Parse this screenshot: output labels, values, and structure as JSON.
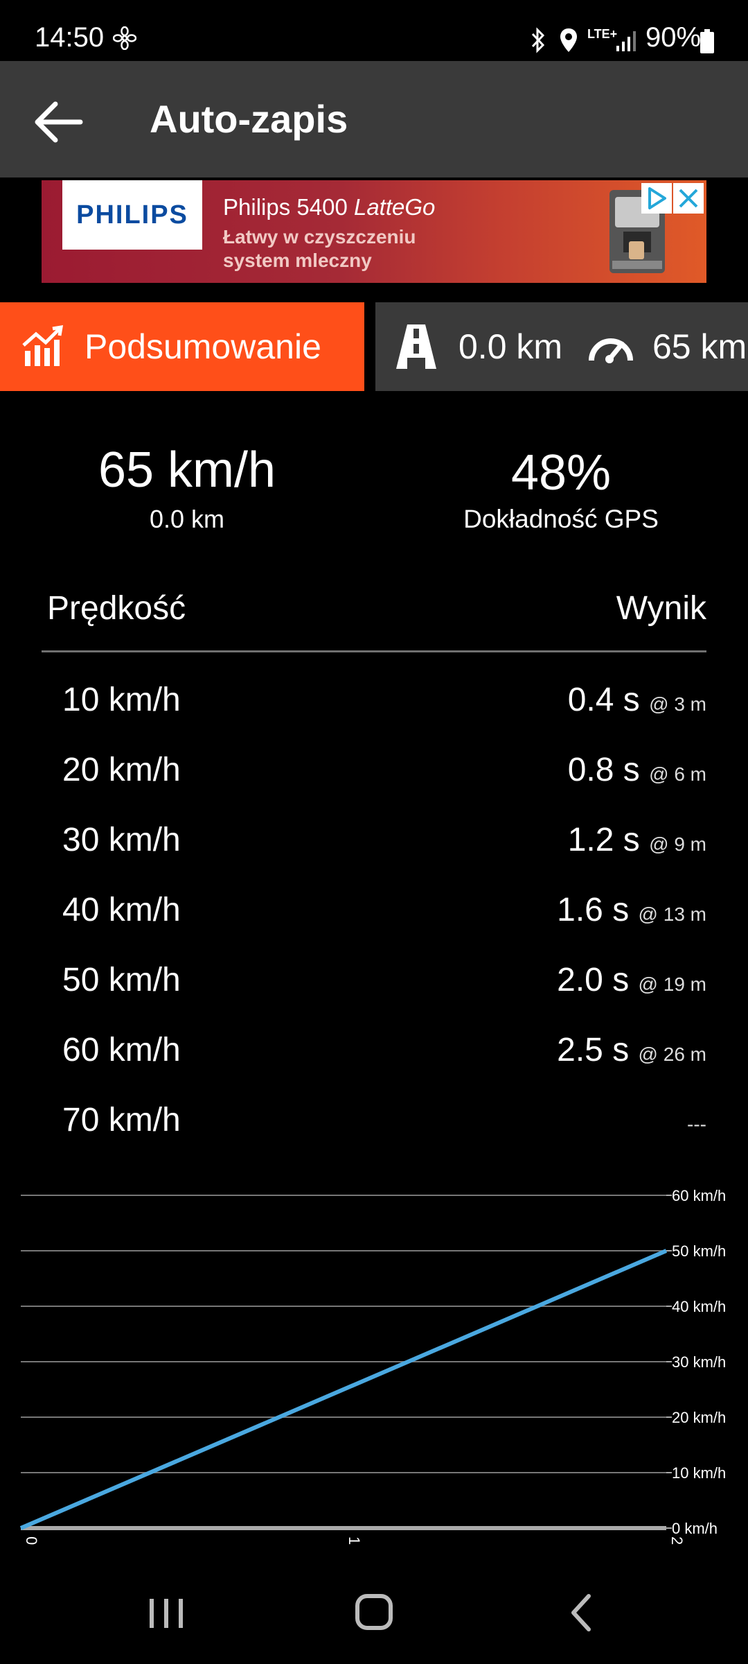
{
  "status_bar": {
    "time": "14:50",
    "network": "LTE+",
    "battery": "90%"
  },
  "app_bar": {
    "title": "Auto-zapis",
    "back_icon": "arrow-left-icon"
  },
  "ad": {
    "brand": "PHILIPS",
    "headline": "Philips 5400",
    "headline_italic": "LatteGo",
    "line1": "Łatwy w czyszczeniu",
    "line2": "system mleczny"
  },
  "tabs": {
    "summary_label": "Podsumowanie",
    "distance": "0.0 km",
    "speed": "65 km"
  },
  "stats": {
    "speed": "65 km/h",
    "distance": "0.0 km",
    "gps_accuracy": "48%",
    "gps_label": "Dokładność GPS"
  },
  "table": {
    "header_speed": "Prędkość",
    "header_result": "Wynik",
    "rows": [
      {
        "speed": "10 km/h",
        "time": "0.4 s",
        "dist": "@ 3 m"
      },
      {
        "speed": "20 km/h",
        "time": "0.8 s",
        "dist": "@ 6 m"
      },
      {
        "speed": "30 km/h",
        "time": "1.2 s",
        "dist": "@ 9 m"
      },
      {
        "speed": "40 km/h",
        "time": "1.6 s",
        "dist": "@ 13 m"
      },
      {
        "speed": "50 km/h",
        "time": "2.0 s",
        "dist": "@ 19 m"
      },
      {
        "speed": "60 km/h",
        "time": "2.5 s",
        "dist": "@ 26 m"
      },
      {
        "speed": "70 km/h",
        "time": "",
        "dist": "---"
      }
    ]
  },
  "chart_data": {
    "type": "line",
    "x": [
      0,
      2
    ],
    "series": [
      {
        "values": [
          0,
          50
        ],
        "color": "#4aa8e0"
      }
    ],
    "y_ticks": [
      "0 km/h",
      "10 km/h",
      "20 km/h",
      "30 km/h",
      "40 km/h",
      "50 km/h",
      "60 km/h"
    ],
    "x_ticks": [
      "0",
      "1",
      "2"
    ],
    "xlim": [
      0,
      2
    ],
    "ylim": [
      0,
      60
    ],
    "grid": true
  },
  "colors": {
    "accent": "#ff4f19",
    "appbar": "#3a3a3a",
    "line": "#4aa8e0"
  }
}
